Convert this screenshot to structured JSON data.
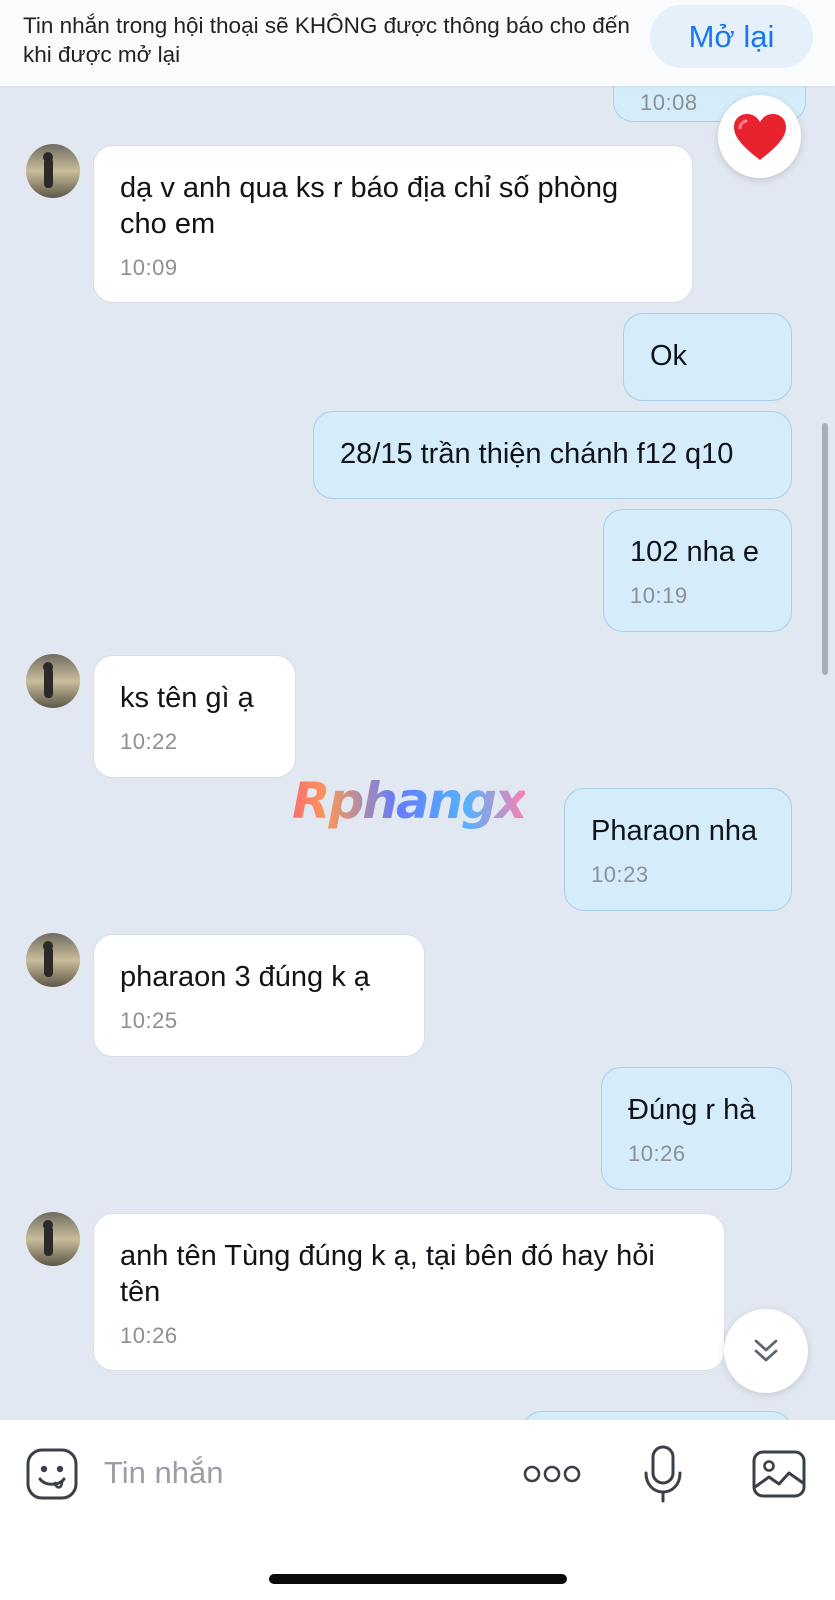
{
  "banner": {
    "text": "Tin nhắn trong hội thoại sẽ KHÔNG được thông báo cho đến khi được mở lại",
    "reopen_label": "Mở lại"
  },
  "messages": [
    {
      "direction": "out",
      "time": "10:08"
    },
    {
      "direction": "in",
      "text": "dạ v anh qua ks r báo địa chỉ số phòng cho em",
      "time": "10:09"
    },
    {
      "direction": "out",
      "text": "Ok"
    },
    {
      "direction": "out",
      "text": "28/15 trần thiện chánh f12 q10"
    },
    {
      "direction": "out",
      "text": "102 nha e",
      "time": "10:19"
    },
    {
      "direction": "in",
      "text": "ks tên gì ạ",
      "time": "10:22"
    },
    {
      "direction": "out",
      "text": "Pharaon nha",
      "time": "10:23"
    },
    {
      "direction": "in",
      "text": "pharaon 3 đúng k ạ",
      "time": "10:25"
    },
    {
      "direction": "out",
      "text": "Đúng r hà",
      "time": "10:26"
    },
    {
      "direction": "in",
      "text": "anh tên Tùng đúng k ạ, tại bên đó hay hỏi tên",
      "time": "10:26"
    }
  ],
  "reaction_icon": "heart-icon",
  "watermark": "Rphangx",
  "input": {
    "placeholder": "Tin nhắn"
  },
  "colors": {
    "chat_background": "#e2e8f1",
    "incoming_bubble": "#ffffff",
    "outgoing_bubble": "#d5ecfb",
    "accent": "#1878f2"
  },
  "icons": [
    "sticker-icon",
    "more-icon",
    "microphone-icon",
    "image-icon",
    "chevron-double-down-icon"
  ]
}
